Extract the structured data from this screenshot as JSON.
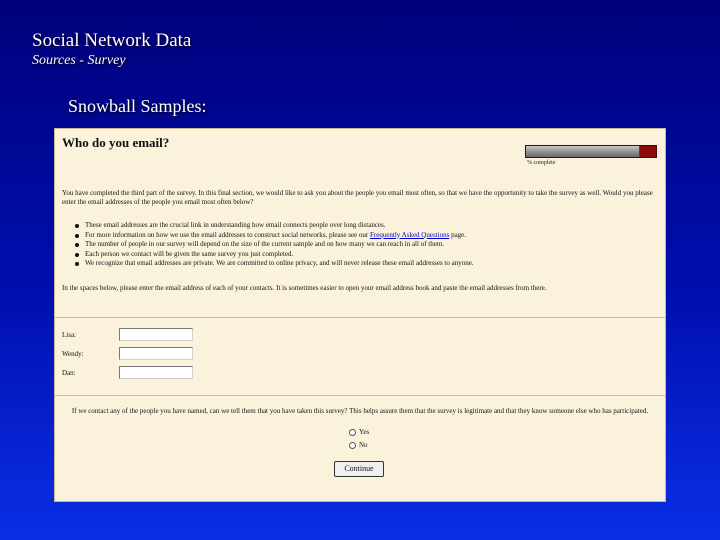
{
  "slide": {
    "title": "Social Network Data",
    "subtitle": "Sources - Survey",
    "section_heading": "Snowball Samples:"
  },
  "form": {
    "heading": "Who do you email?",
    "progress": {
      "fraction": 0.88,
      "label": "% complete"
    },
    "intro": "You have completed the third part of the survey. In this final section, we would like to ask you about the people you email most often, so that we have the opportunity to take the survey as well. Would you please enter the email addresses of the people you email most often below?",
    "bullets": [
      {
        "text": "These email addresses are the crucial link in understanding how email connects people over long distances."
      },
      {
        "text": "For more information on how we use the email addresses to construct social networks, please see our ",
        "link": "Frequently Asked Questions",
        "after": " page."
      },
      {
        "text": "The number of people in our survey will depend on the size of the current sample and on how many we can reach in all of them."
      },
      {
        "text": "Each person we contact will be given the same survey you just completed."
      },
      {
        "text": "We recognize that email addresses are private. We are committed to online privacy, and will never release these email addresses to anyone."
      }
    ],
    "instructions": "In the spaces below, please enter the email address of each of your contacts. It is sometimes easier to open your email address book and paste the email addresses from there.",
    "fields": [
      {
        "label": "Lisa:",
        "value": ""
      },
      {
        "label": "Wendy:",
        "value": ""
      },
      {
        "label": "Dan:",
        "value": ""
      }
    ],
    "question": "If we contact any of the people you have named, can we tell them that you have taken this survey? This helps assure them that the survey is legitimate and that they know someone else who has participated.",
    "options": [
      "Yes",
      "No"
    ],
    "continue_label": "Continue"
  }
}
